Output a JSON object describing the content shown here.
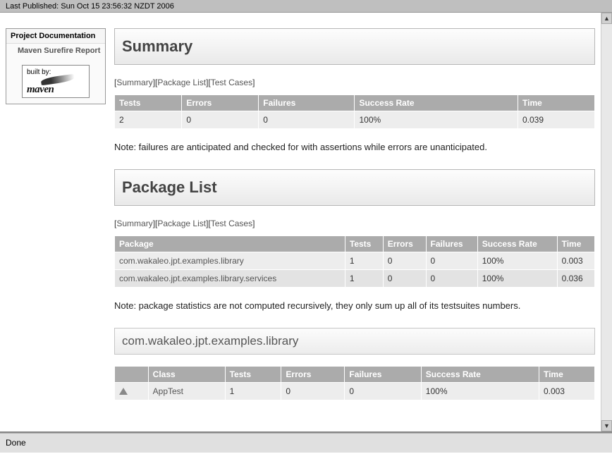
{
  "top": {
    "last_published": "Last Published: Sun Oct 15 23:56:32 NZDT 2006"
  },
  "sidebar": {
    "title": "Project Documentation",
    "item": "Maven Surefire Report",
    "logo": {
      "built_by": "built by:",
      "name": "maven"
    }
  },
  "nav": {
    "summary": "Summary",
    "package_list": "Package List",
    "test_cases": "Test Cases"
  },
  "summary": {
    "heading": "Summary",
    "cols": {
      "tests": "Tests",
      "errors": "Errors",
      "failures": "Failures",
      "success": "Success Rate",
      "time": "Time"
    },
    "row": {
      "tests": "2",
      "errors": "0",
      "failures": "0",
      "success": "100%",
      "time": "0.039"
    },
    "note": "Note: failures are anticipated and checked for with assertions while errors are unanticipated."
  },
  "package_list": {
    "heading": "Package List",
    "cols": {
      "package": "Package",
      "tests": "Tests",
      "errors": "Errors",
      "failures": "Failures",
      "success": "Success Rate",
      "time": "Time"
    },
    "rows": [
      {
        "package": "com.wakaleo.jpt.examples.library",
        "tests": "1",
        "errors": "0",
        "failures": "0",
        "success": "100%",
        "time": "0.003"
      },
      {
        "package": "com.wakaleo.jpt.examples.library.services",
        "tests": "1",
        "errors": "0",
        "failures": "0",
        "success": "100%",
        "time": "0.036"
      }
    ],
    "note": "Note: package statistics are not computed recursively, they only sum up all of its testsuites numbers."
  },
  "pkg_detail": {
    "name": "com.wakaleo.jpt.examples.library",
    "cols": {
      "class": "Class",
      "tests": "Tests",
      "errors": "Errors",
      "failures": "Failures",
      "success": "Success Rate",
      "time": "Time"
    },
    "row": {
      "class": "AppTest",
      "tests": "1",
      "errors": "0",
      "failures": "0",
      "success": "100%",
      "time": "0.003"
    }
  },
  "status": {
    "text": "Done"
  }
}
